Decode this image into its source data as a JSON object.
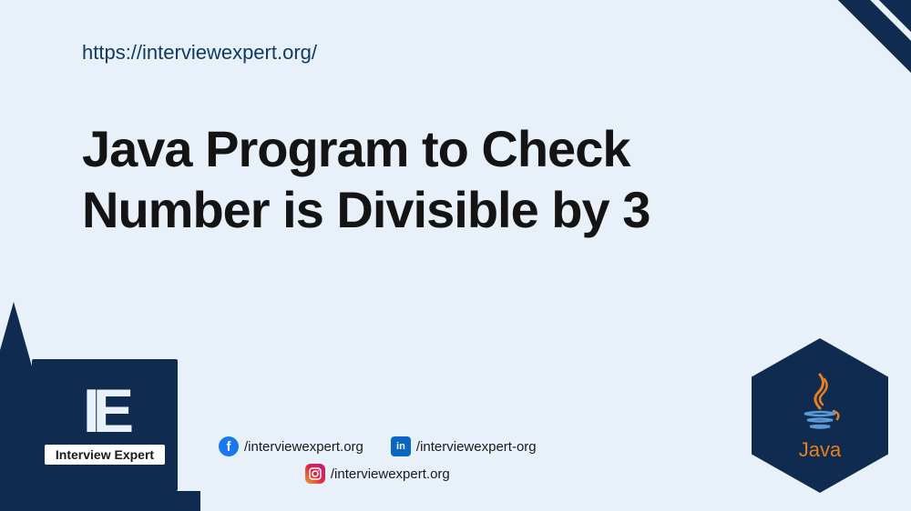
{
  "url": "https://interviewexpert.org/",
  "title_line1": "Java Program to Check",
  "title_line2": "Number is Divisible by 3",
  "logo": {
    "initials": "IE",
    "name": "Interview Expert"
  },
  "social": {
    "facebook": "/interviewexpert.org",
    "linkedin": "/interviewexpert-org",
    "instagram": "/interviewexpert.org"
  },
  "tech_label": "Java"
}
